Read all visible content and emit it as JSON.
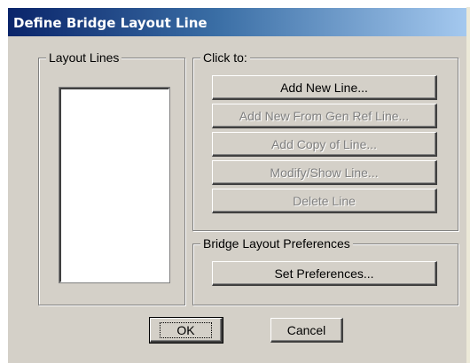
{
  "window": {
    "title": "Define Bridge Layout Line"
  },
  "layout_lines_group": {
    "label": "Layout Lines",
    "items": []
  },
  "click_to_group": {
    "label": "Click to:",
    "buttons": [
      {
        "label": "Add New Line...",
        "enabled": true
      },
      {
        "label": "Add New From Gen Ref Line...",
        "enabled": false
      },
      {
        "label": "Add Copy of Line...",
        "enabled": false
      },
      {
        "label": "Modify/Show Line...",
        "enabled": false
      },
      {
        "label": "Delete Line",
        "enabled": false
      }
    ]
  },
  "preferences_group": {
    "label": "Bridge Layout Preferences",
    "button_label": "Set Preferences..."
  },
  "footer": {
    "ok_label": "OK",
    "cancel_label": "Cancel"
  }
}
